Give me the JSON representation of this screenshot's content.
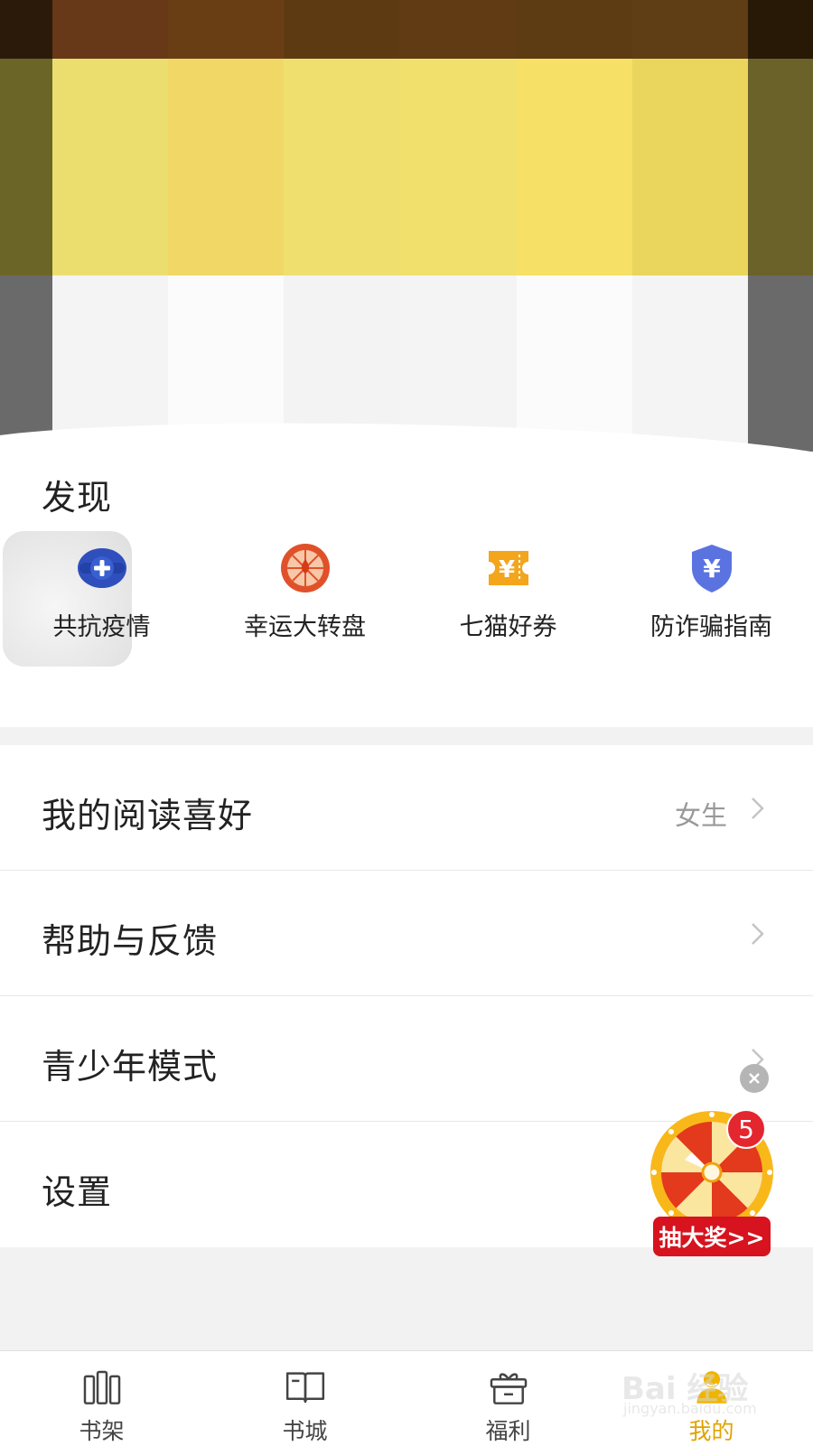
{
  "discover": {
    "title": "发现",
    "items": [
      {
        "label": "共抗疫情",
        "icon": "medical-plus-icon",
        "color": "#2f4fbd"
      },
      {
        "label": "幸运大转盘",
        "icon": "lucky-wheel-icon",
        "color": "#e0512a"
      },
      {
        "label": "七猫好券",
        "icon": "coupon-ticket-icon",
        "color": "#f3a51c"
      },
      {
        "label": "防诈骗指南",
        "icon": "shield-yuan-icon",
        "color": "#5b73e0"
      }
    ]
  },
  "menu": {
    "reading_pref": {
      "label": "我的阅读喜好",
      "value": "女生"
    },
    "help": {
      "label": "帮助与反馈"
    },
    "youth": {
      "label": "青少年模式"
    },
    "settings": {
      "label": "设置"
    }
  },
  "lottery": {
    "badge_count": "5",
    "label": "抽大奖>>"
  },
  "tabbar": {
    "active_color": "#e1a300",
    "tabs": [
      {
        "label": "书架",
        "icon": "bookshelf-icon"
      },
      {
        "label": "书城",
        "icon": "open-book-icon"
      },
      {
        "label": "福利",
        "icon": "gift-icon"
      },
      {
        "label": "我的",
        "icon": "user-icon",
        "active": true
      }
    ]
  },
  "watermark": {
    "main": "Bai 经验",
    "sub": "jingyan.baidu.com"
  }
}
